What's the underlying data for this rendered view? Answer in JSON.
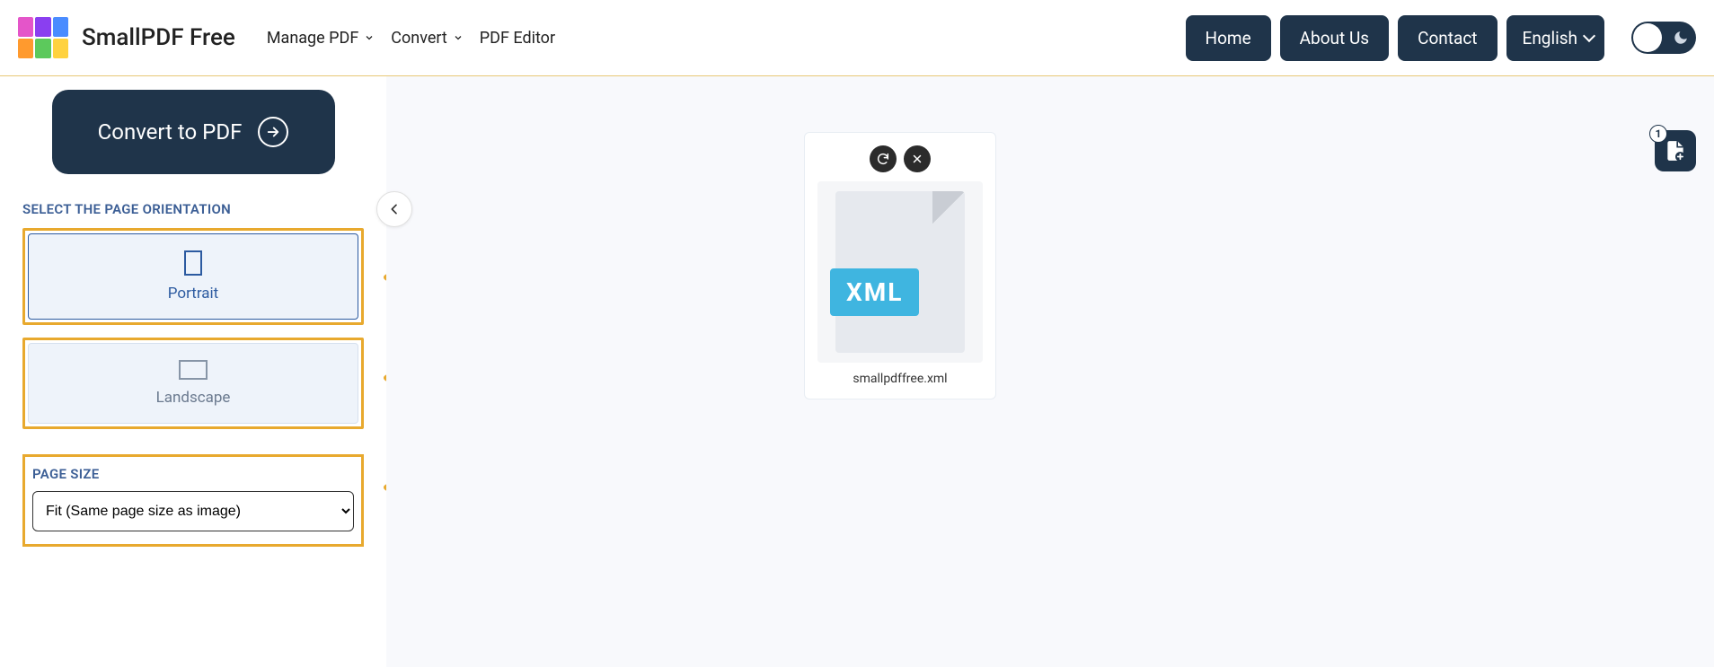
{
  "header": {
    "brand": "SmallPDF Free",
    "nav": {
      "manage": "Manage PDF",
      "convert": "Convert",
      "editor": "PDF Editor"
    },
    "buttons": {
      "home": "Home",
      "about": "About Us",
      "contact": "Contact"
    },
    "language": "English"
  },
  "sidebar": {
    "convert_label": "Convert to PDF",
    "orientation_title": "SELECT THE PAGE ORIENTATION",
    "portrait": "Portrait",
    "landscape": "Landscape",
    "page_size_title": "PAGE SIZE",
    "page_size_value": "Fit (Same page size as image)"
  },
  "file": {
    "name": "smallpdffree.xml",
    "type_label": "XML",
    "count": "1"
  }
}
